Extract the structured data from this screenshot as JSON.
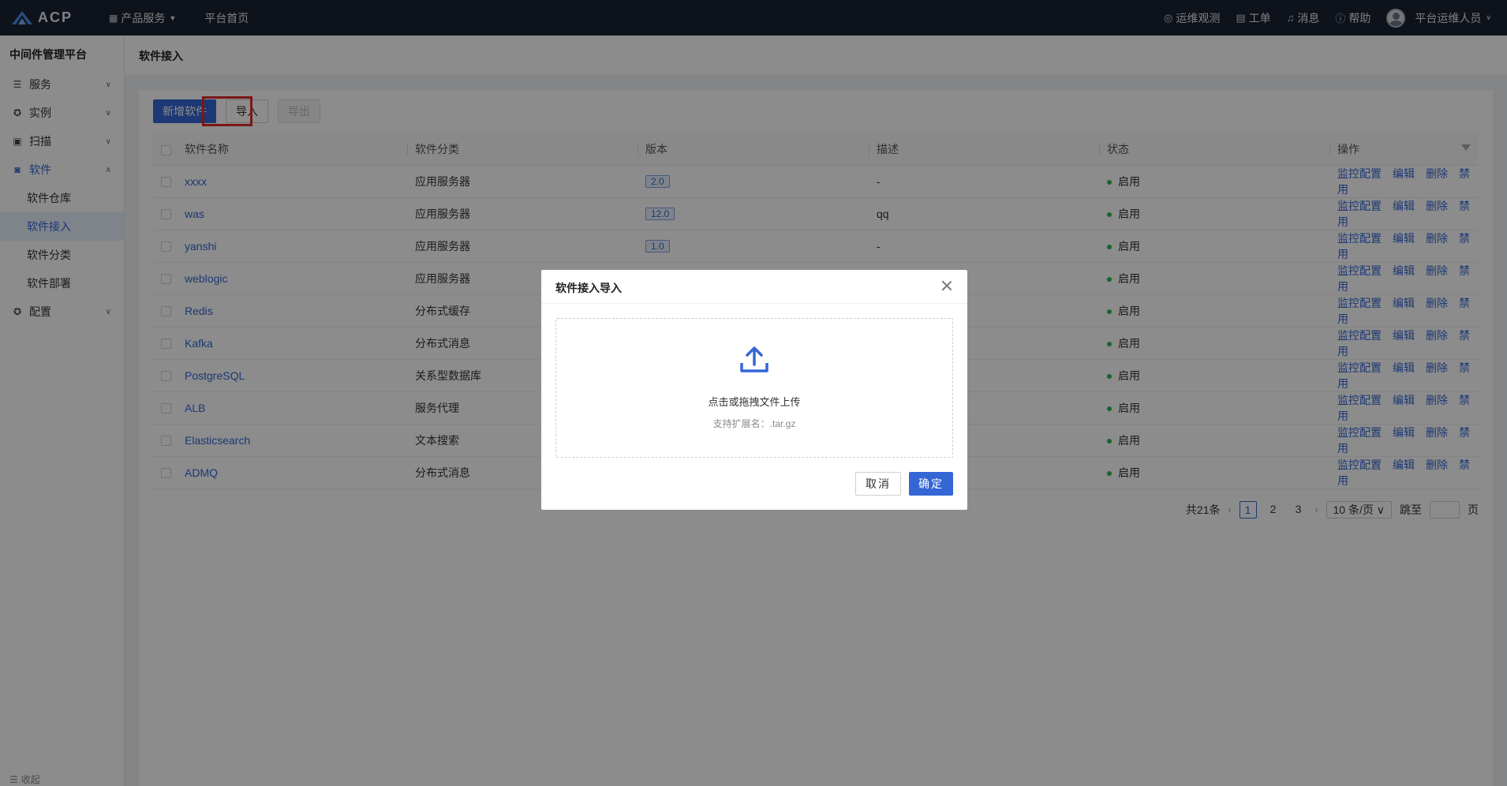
{
  "brand": {
    "logo_text": "ACP"
  },
  "topnav": {
    "products_label": "产品服务",
    "home_label": "平台首页",
    "ops_watch": "运维观测",
    "workorder": "工单",
    "messages": "消息",
    "help": "帮助",
    "user": "平台运维人员"
  },
  "sidebar": {
    "title": "中间件管理平台",
    "items": [
      {
        "label": "服务",
        "icon": "list-icon"
      },
      {
        "label": "实例",
        "icon": "gear-icon"
      },
      {
        "label": "扫描",
        "icon": "scan-icon"
      },
      {
        "label": "软件",
        "icon": "box-icon"
      }
    ],
    "sub_items": [
      "软件仓库",
      "软件接入",
      "软件分类",
      "软件部署"
    ],
    "config_label": "配置",
    "collapse_label": "收起"
  },
  "page": {
    "title": "软件接入"
  },
  "toolbar": {
    "add_label": "新增软件",
    "import_label": "导入",
    "export_label": "导出"
  },
  "table": {
    "headers": [
      "软件名称",
      "软件分类",
      "版本",
      "描述",
      "状态",
      "操作"
    ],
    "rows": [
      {
        "name": "xxxx",
        "category": "应用服务器",
        "version": "2.0",
        "desc": "-",
        "status": "启用"
      },
      {
        "name": "was",
        "category": "应用服务器",
        "version": "12.0",
        "desc": "qq",
        "status": "启用"
      },
      {
        "name": "yanshi",
        "category": "应用服务器",
        "version": "1.0",
        "desc": "-",
        "status": "启用"
      },
      {
        "name": "weblogic",
        "category": "应用服务器",
        "version": "",
        "desc": "",
        "status": "启用"
      },
      {
        "name": "Redis",
        "category": "分布式缓存",
        "version": "",
        "desc": "",
        "status": "启用"
      },
      {
        "name": "Kafka",
        "category": "分布式消息",
        "version": "",
        "desc": "",
        "status": "启用"
      },
      {
        "name": "PostgreSQL",
        "category": "关系型数据库",
        "version": "",
        "desc": "",
        "status": "启用"
      },
      {
        "name": "ALB",
        "category": "服务代理",
        "version": "",
        "desc": "",
        "status": "启用"
      },
      {
        "name": "Elasticsearch",
        "category": "文本搜索",
        "version": "",
        "desc": "",
        "status": "启用"
      },
      {
        "name": "ADMQ",
        "category": "分布式消息",
        "version": "",
        "desc": "",
        "status": "启用"
      }
    ],
    "ops": [
      "监控配置",
      "编辑",
      "删除",
      "禁用"
    ]
  },
  "pagination": {
    "total": "共21条",
    "pages": [
      "1",
      "2",
      "3"
    ],
    "page_size": "10 条/页",
    "jump_label": "跳至",
    "page_suffix": "页"
  },
  "modal": {
    "title": "软件接入导入",
    "upload_text": "点击或拖拽文件上传",
    "upload_hint": "支持扩展名：.tar.gz",
    "cancel_label": "取消",
    "ok_label": "确定"
  },
  "colors": {
    "primary": "#3466d6",
    "topbar": "#1b2230",
    "status_green": "#2db84d",
    "highlight_red": "#e12b2b"
  }
}
